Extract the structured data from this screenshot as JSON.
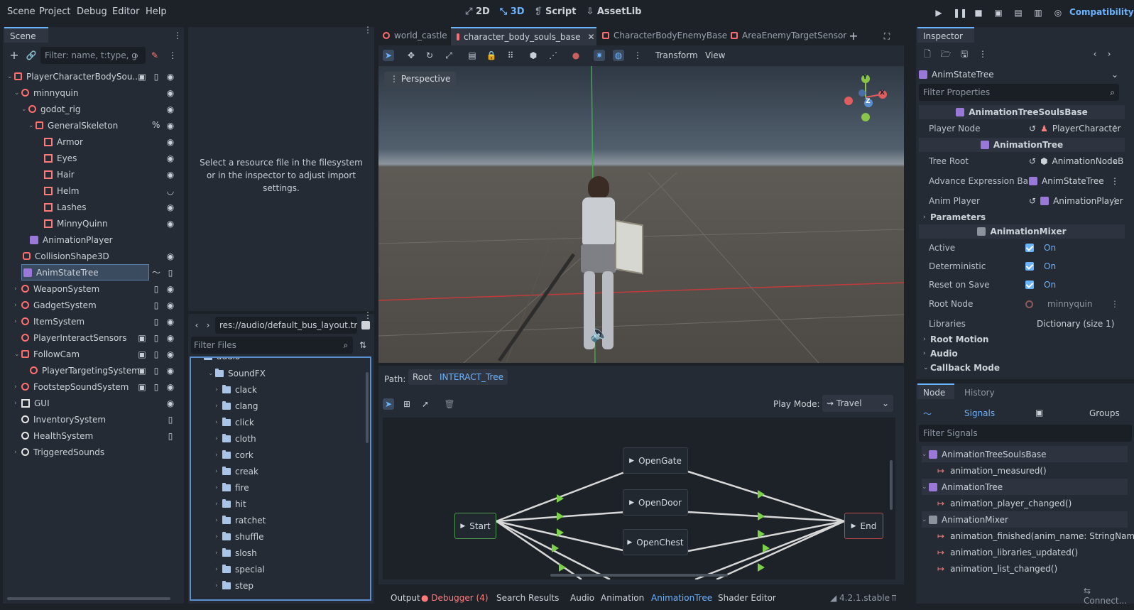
{
  "menu": [
    "Scene",
    "Project",
    "Debug",
    "Editor",
    "Help"
  ],
  "toolbar": {
    "mode_2d": "2D",
    "mode_3d": "3D",
    "script": "Script",
    "assetlib": "AssetLib",
    "renderer": "Compatibility"
  },
  "scene_dock": {
    "tab": "Scene",
    "filter_placeholder": "Filter: name, t:type, g",
    "nodes": [
      {
        "label": "PlayerCharacterBodySou..."
      },
      {
        "label": "minnyquin"
      },
      {
        "label": "godot_rig"
      },
      {
        "label": "GeneralSkeleton",
        "suffix": "%"
      },
      {
        "label": "Armor"
      },
      {
        "label": "Eyes"
      },
      {
        "label": "Hair"
      },
      {
        "label": "Helm"
      },
      {
        "label": "Lashes"
      },
      {
        "label": "MinnyQuinn"
      },
      {
        "label": "AnimationPlayer"
      },
      {
        "label": "CollisionShape3D"
      },
      {
        "label": "AnimStateTree"
      },
      {
        "label": "WeaponSystem"
      },
      {
        "label": "GadgetSystem"
      },
      {
        "label": "ItemSystem"
      },
      {
        "label": "PlayerInteractSensors"
      },
      {
        "label": "FollowCam"
      },
      {
        "label": "PlayerTargetingSystem"
      },
      {
        "label": "FootstepSoundSystem"
      },
      {
        "label": "GUI"
      },
      {
        "label": "InventorySystem"
      },
      {
        "label": "HealthSystem"
      },
      {
        "label": "TriggeredSounds"
      }
    ]
  },
  "import_dock": {
    "message": "Select a resource file in the filesystem or in the inspector to adjust import settings."
  },
  "filesystem": {
    "path": "res://audio/default_bus_layout.tre",
    "filter_placeholder": "Filter Files",
    "folders": [
      "audio",
      "SoundFX",
      "clack",
      "clang",
      "click",
      "cloth",
      "cork",
      "creak",
      "fire",
      "hit",
      "ratchet",
      "shuffle",
      "slosh",
      "special",
      "step"
    ]
  },
  "editor_tabs": [
    "world_castle",
    "character_body_souls_base",
    "CharacterBodyEnemyBase",
    "AreaEnemyTargetSensor"
  ],
  "viewport": {
    "menu_transform": "Transform",
    "menu_view": "View",
    "perspective_label": "Perspective",
    "gizmo_axes": [
      "Y",
      "Z",
      "X"
    ]
  },
  "anim_tree": {
    "path_label": "Path:",
    "path_root": "Root",
    "path_current": "INTERACT_Tree",
    "play_mode_label": "Play Mode:",
    "play_mode_value": "Travel",
    "nodes": [
      "Start",
      "OpenGate",
      "OpenDoor",
      "OpenChest",
      "End"
    ]
  },
  "bottom_panel": {
    "tabs": [
      "Output",
      "Debugger (4)",
      "Search Results",
      "Audio",
      "Animation",
      "AnimationTree",
      "Shader Editor"
    ],
    "version": "4.2.1.stable"
  },
  "inspector": {
    "tab": "Inspector",
    "object_name": "AnimStateTree",
    "filter_placeholder": "Filter Properties",
    "sections": {
      "s1": "AnimationTreeSoulsBase",
      "s2": "AnimationTree",
      "s3": "AnimationMixer"
    },
    "props": {
      "player_node_label": "Player Node",
      "player_node_value": "PlayerCharacter",
      "tree_root_label": "Tree Root",
      "tree_root_value": "AnimationNodeB",
      "adv_expr_label": "Advance Expression Ba...",
      "adv_expr_value": "AnimStateTree",
      "anim_player_label": "Anim Player",
      "anim_player_value": "AnimationPlayer",
      "parameters": "Parameters",
      "active_label": "Active",
      "active_value": "On",
      "deterministic_label": "Deterministic",
      "deterministic_value": "On",
      "reset_label": "Reset on Save",
      "reset_value": "On",
      "root_node_label": "Root Node",
      "root_node_value": "minnyquin",
      "libraries_label": "Libraries",
      "libraries_value": "Dictionary (size 1)",
      "root_motion": "Root Motion",
      "audio": "Audio",
      "callback_mode": "Callback Mode"
    }
  },
  "node_dock": {
    "tabs": [
      "Node",
      "History"
    ],
    "signals_label": "Signals",
    "groups_label": "Groups",
    "filter_placeholder": "Filter Signals",
    "classes": [
      {
        "name": "AnimationTreeSoulsBase",
        "signals": [
          "animation_measured()"
        ]
      },
      {
        "name": "AnimationTree",
        "signals": [
          "animation_player_changed()"
        ]
      },
      {
        "name": "AnimationMixer",
        "signals": [
          "animation_finished(anim_name: StringName)",
          "animation_libraries_updated()",
          "animation_list_changed()"
        ]
      }
    ],
    "connect_label": "Connect..."
  }
}
